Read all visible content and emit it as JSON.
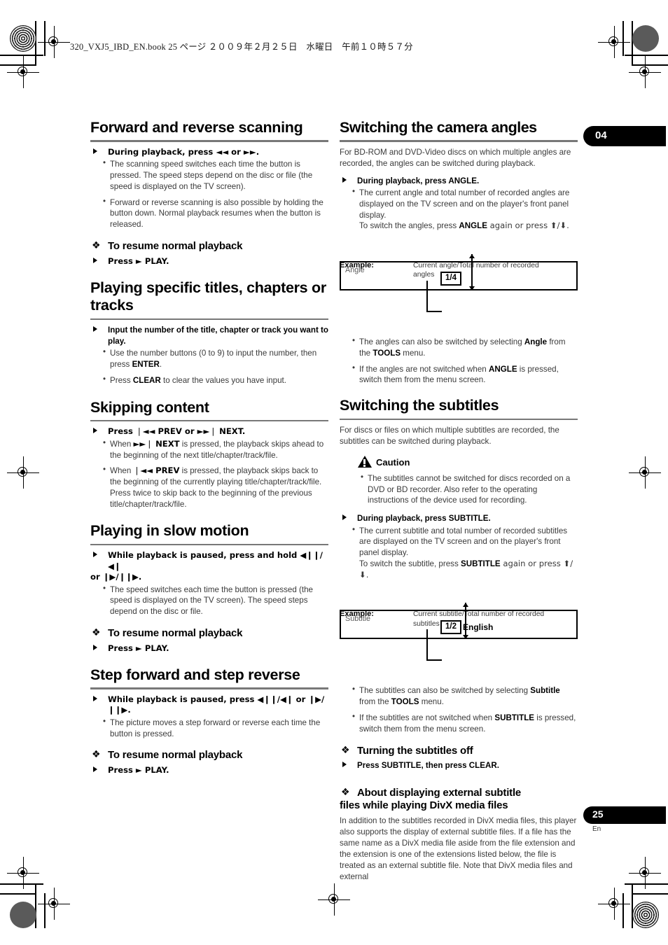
{
  "slug": {
    "text": "320_VXJ5_IBD_EN.book   25 ページ   ２００９年２月２５日　水曜日　午前１０時５７分"
  },
  "chapter_tab": {
    "number": "04"
  },
  "page_badge": {
    "number": "25",
    "language": "En"
  },
  "left_column": {
    "s1": {
      "heading": "Forward and reverse scanning",
      "action": "During playback, press ◄◄ or ►►.",
      "bullets": [
        "The scanning speed switches each time the button is pressed. The speed steps depend on the disc or file (the speed is displayed on the TV screen).",
        "Forward or reverse scanning is also possible by holding the button down. Normal playback resumes when the button is released."
      ],
      "sub_heading": "To resume normal playback",
      "sub_action": "Press ► PLAY."
    },
    "s2": {
      "heading": "Playing specific titles, chapters or tracks",
      "action": "Input the number of the title, chapter or track you want to play.",
      "bullet1_a": "Use the number buttons (0 to 9) to input the number, then press ",
      "bullet1_b": "ENTER",
      "bullet1_c": ".",
      "bullet2_a": "Press ",
      "bullet2_b": "CLEAR",
      "bullet2_c": " to clear the values you have input."
    },
    "s3": {
      "heading": "Skipping content",
      "action": "Press ❘◄◄ PREV or ►►❘ NEXT.",
      "b1_a": "When ",
      "b1_b": "►►❘ NEXT",
      "b1_c": " is pressed, the playback skips ahead to the beginning of the next title/chapter/track/file.",
      "b2_a": "When ",
      "b2_b": "❘◄◄ PREV",
      "b2_c": " is pressed, the playback skips back to the beginning of the currently playing title/chapter/track/file. Press twice to skip back to the beginning of the previous title/chapter/track/file."
    },
    "s4": {
      "heading": "Playing in slow motion",
      "action_line1": "While playback is paused, press and hold ◀❙❙/◀❙",
      "action_line2": "or ❙▶/❙❙▶.",
      "bullet": "The speed switches each time the button is pressed (the speed is displayed on the TV screen). The speed steps depend on the disc or file.",
      "sub_heading": "To resume normal playback",
      "sub_action": "Press ► PLAY."
    },
    "s5": {
      "heading": "Step forward and step reverse",
      "action": "While playback is paused, press ◀❙❙/◀❙ or ❙▶/❙❙▶.",
      "bullet": "The picture moves a step forward or reverse each time the button is pressed.",
      "sub_heading": "To resume normal playback",
      "sub_action": "Press ► PLAY."
    }
  },
  "right_column": {
    "s1": {
      "heading": "Switching the camera angles",
      "intro": "For BD-ROM and DVD-Video discs on which multiple angles are recorded, the angles can be switched during playback.",
      "action": "During playback, press ANGLE.",
      "bullet_a": "The current angle and total number of recorded angles are displayed on the TV screen and on the player's front panel display.",
      "bullet_b1": "To switch the angles, press ",
      "bullet_b2": "ANGLE",
      "bullet_b3": " again or press ⬆/⬇.",
      "example_label": "Example:",
      "example_caption": "Current angle/Total number of recorded angles",
      "screen_label": "Angle",
      "osd_number": "1/4",
      "osd_text": "",
      "post_b1_a": "The angles can also be switched by selecting ",
      "post_b1_b": "Angle",
      "post_b1_c": " from the ",
      "post_b1_d": "TOOLS",
      "post_b1_e": " menu.",
      "post_b2_a": "If the angles are not switched when ",
      "post_b2_b": "ANGLE",
      "post_b2_c": " is pressed, switch them from the menu screen."
    },
    "s2": {
      "heading": "Switching the subtitles",
      "intro": "For discs or files on which multiple subtitles are recorded, the subtitles can be switched during playback.",
      "caution_title": "Caution",
      "caution_bullet": "The subtitles cannot be switched for discs recorded on a DVD or BD recorder. Also refer to the operating instructions of the device used for recording.",
      "action": "During playback, press SUBTITLE.",
      "bullet_a": "The current subtitle and total number of recorded subtitles are displayed on the TV screen and on the player's front panel display.",
      "bullet_b1": "To switch the subtitle, press ",
      "bullet_b2": "SUBTITLE",
      "bullet_b3": " again or press ⬆/⬇.",
      "example_label": "Example:",
      "example_caption": "Current subtitle/Total number of recorded subtitles",
      "screen_label": "Subtitle",
      "osd_number": "1/2",
      "osd_text": "English",
      "post_b1_a": "The subtitles can also be switched by selecting ",
      "post_b1_b": "Subtitle",
      "post_b1_c": " from the ",
      "post_b1_d": "TOOLS",
      "post_b1_e": " menu.",
      "post_b2_a": "If the subtitles are not switched when ",
      "post_b2_b": "SUBTITLE",
      "post_b2_c": " is pressed, switch them from the menu screen.",
      "off_heading": "Turning the subtitles off",
      "off_action": "Press SUBTITLE, then press CLEAR.",
      "divx_heading_l1": "About displaying external subtitle",
      "divx_heading_l2": "files while playing DivX media files",
      "divx_para": "In addition to the subtitles recorded in DivX media files, this player also supports the display of external subtitle files. If a file has the same name as a DivX media file aside from the file extension and the extension is one of the extensions listed below, the file is treated as an external subtitle file. Note that DivX media files and external"
    }
  }
}
